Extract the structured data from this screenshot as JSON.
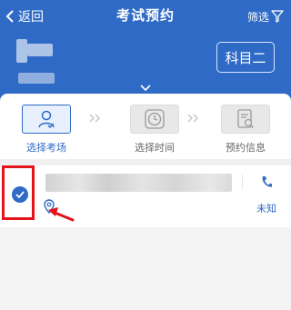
{
  "header": {
    "back_label": "返回",
    "title": "考试预约",
    "filter_label": "筛选",
    "subject_badge": "科目二"
  },
  "steps": [
    {
      "label": "选择考场",
      "icon": "person-icon",
      "active": true
    },
    {
      "label": "选择时间",
      "icon": "clock-icon",
      "active": false
    },
    {
      "label": "预约信息",
      "icon": "document-search-icon",
      "active": false
    }
  ],
  "venue": {
    "status_text": "未知",
    "selected": true
  },
  "colors": {
    "primary": "#2f6bc6",
    "highlight_red": "#e3141b"
  }
}
